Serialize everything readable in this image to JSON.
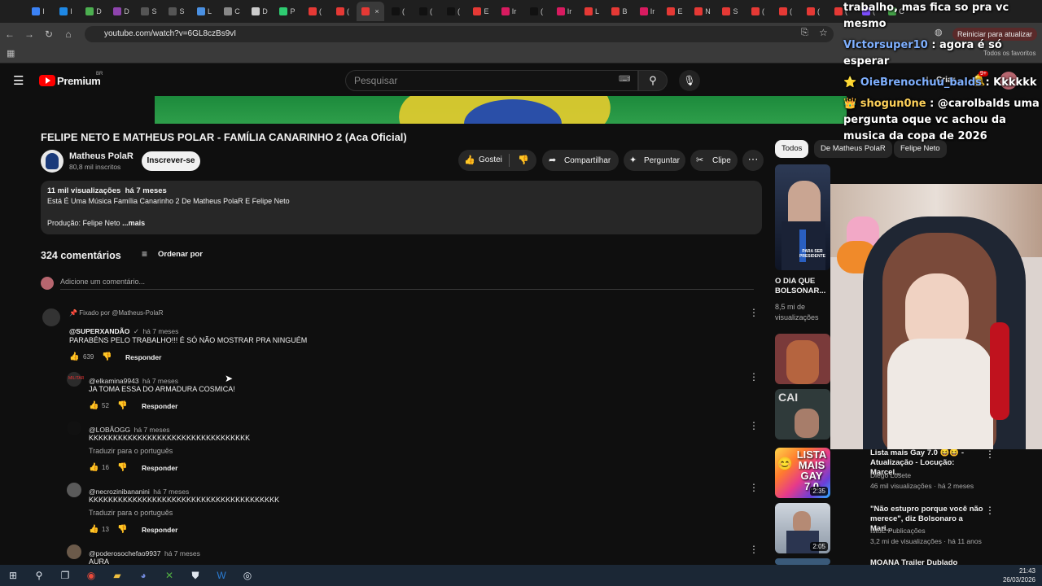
{
  "browser": {
    "tabs": [
      {
        "label": "I",
        "color": "#3b82f6"
      },
      {
        "label": "I",
        "color": "#1e88e5"
      },
      {
        "label": "D",
        "color": "#4caf50"
      },
      {
        "label": "D",
        "color": "#8e44ad"
      },
      {
        "label": "S",
        "color": "#555555"
      },
      {
        "label": "S",
        "color": "#555555"
      },
      {
        "label": "L",
        "color": "#4a90e2"
      },
      {
        "label": "C",
        "color": "#888888"
      },
      {
        "label": "D",
        "color": "#cccccc"
      },
      {
        "label": "P",
        "color": "#2ecc71"
      },
      {
        "label": "(",
        "color": "#e53935"
      },
      {
        "label": "(",
        "color": "#e53935"
      },
      {
        "label": "",
        "color": "#e53935"
      },
      {
        "label": "(",
        "color": "#111111"
      },
      {
        "label": "(",
        "color": "#111111"
      },
      {
        "label": "(",
        "color": "#111111"
      },
      {
        "label": "E",
        "color": "#e53935"
      },
      {
        "label": "Ir",
        "color": "#d81b60"
      },
      {
        "label": "(",
        "color": "#111111"
      },
      {
        "label": "Ir",
        "color": "#d81b60"
      },
      {
        "label": "L",
        "color": "#e53935"
      },
      {
        "label": "B",
        "color": "#e53935"
      },
      {
        "label": "Ir",
        "color": "#d81b60"
      },
      {
        "label": "E",
        "color": "#e53935"
      },
      {
        "label": "N",
        "color": "#e53935"
      },
      {
        "label": "S",
        "color": "#e53935"
      },
      {
        "label": "(",
        "color": "#e53935"
      },
      {
        "label": "(",
        "color": "#e53935"
      },
      {
        "label": "(",
        "color": "#e53935"
      },
      {
        "label": "(",
        "color": "#e53935"
      },
      {
        "label": "(",
        "color": "#7c4dff"
      },
      {
        "label": "C",
        "color": "#43a047"
      }
    ],
    "url": "youtube.com/watch?v=6GL8czBs9vI",
    "restart_label": "Reiniciar para atualizar",
    "all_favorites": "Todos os favoritos"
  },
  "header": {
    "logo_text": "Premium",
    "logo_region": "BR",
    "search_placeholder": "Pesquisar",
    "create_label": "Criar",
    "notif_badge": "9+"
  },
  "video": {
    "title": "FELIPE NETO E MATHEUS POLAR - FAMÍLIA CANARINHO 2 (Aca Oficial)",
    "channel": "Matheus PolaR",
    "subscribers": "80,8 mil inscritos",
    "subscribe_label": "Inscrever-se",
    "like_label": "Gostei",
    "share_label": "Compartilhar",
    "ask_label": "Perguntar",
    "clip_label": "Clipe",
    "views": "11 mil visualizações",
    "age": "há 7 meses",
    "desc_line1": "Está É Uma Música Família Canarinho 2 De Matheus PolaR E Felipe Neto",
    "desc_line2": "Produção: Felipe Neto",
    "more_label": "...mais"
  },
  "comments": {
    "count_label": "324 comentários",
    "sort_label": "Ordenar por",
    "add_placeholder": "Adicione um comentário...",
    "pinned_label": "Fixado por @Matheus-PolaR",
    "reply_label": "Responder",
    "translate_label": "Traduzir para o português",
    "items": [
      {
        "user": "@SUPERXANDÃO",
        "time": "há 7 meses",
        "text": "PARABÉNS PELO TRABALHO!!! É SÓ NÃO MOSTRAR PRA NINGUÉM",
        "likes": "639"
      },
      {
        "user": "@elkamina9943",
        "time": "há 7 meses",
        "text": "JA TOMA ESSA DO ARMADURA COSMICA!",
        "likes": "52"
      },
      {
        "user": "@LOBÃOGG",
        "time": "há 7 meses",
        "text": "KKKKKKKKKKKKKKKKKKKKKKKKKKKKKKKKK",
        "likes": "16"
      },
      {
        "user": "@necrozinibananini",
        "time": "há 7 meses",
        "text": "KKKKKKKKKKKKKKKKKKKKKKKKKKKKKKKKKKKKKKK",
        "likes": "13"
      },
      {
        "user": "@poderosochefao9937",
        "time": "há 7 meses",
        "text": "AURA",
        "likes": ""
      }
    ]
  },
  "sidebar": {
    "chips": [
      "Todos",
      "De Matheus PolaR",
      "Felipe Neto"
    ],
    "recs": [
      {
        "title": "O DIA QUE BOLSONAR...",
        "meta1": "8,5 mi de",
        "meta2": "visualizações",
        "duration": ""
      },
      {
        "title": "Lista mais Gay 7.0 😆😆 - Atualização - Locução: Marcel...",
        "channel": "Diego Losete",
        "meta": "46 mil visualizações · há 2 meses",
        "duration": "2:35",
        "thumb_text": "LISTA MAIS GAY 7.0"
      },
      {
        "title": "\"Não estupro porque você não merece\", diz Bolsonaro a Mari...",
        "channel": "IstoÉ Publicações",
        "meta": "3,2 mi de visualizações · há 11 anos",
        "duration": "2:05"
      },
      {
        "title": "MOANA Trailer Dublado Oficial...",
        "channel": "",
        "meta": "",
        "duration": ""
      }
    ],
    "thumb1_caption": "PARA SER PRESIDENTE"
  },
  "stream_chat": {
    "lines": [
      {
        "name": "",
        "text": "trabalho, mas fica so pra vc mesmo"
      },
      {
        "name": "VIctorsuper10",
        "text": ": agora é só esperar"
      },
      {
        "name": "OieBrenochuu_balds",
        "text": ": Kkkkkk"
      },
      {
        "name": "shogun0ne",
        "text": ": @carolbalds uma pergunta oque vc achou da musica da copa de 2026"
      }
    ]
  },
  "taskbar": {
    "time": "21:43",
    "date": "26/03/2026"
  }
}
